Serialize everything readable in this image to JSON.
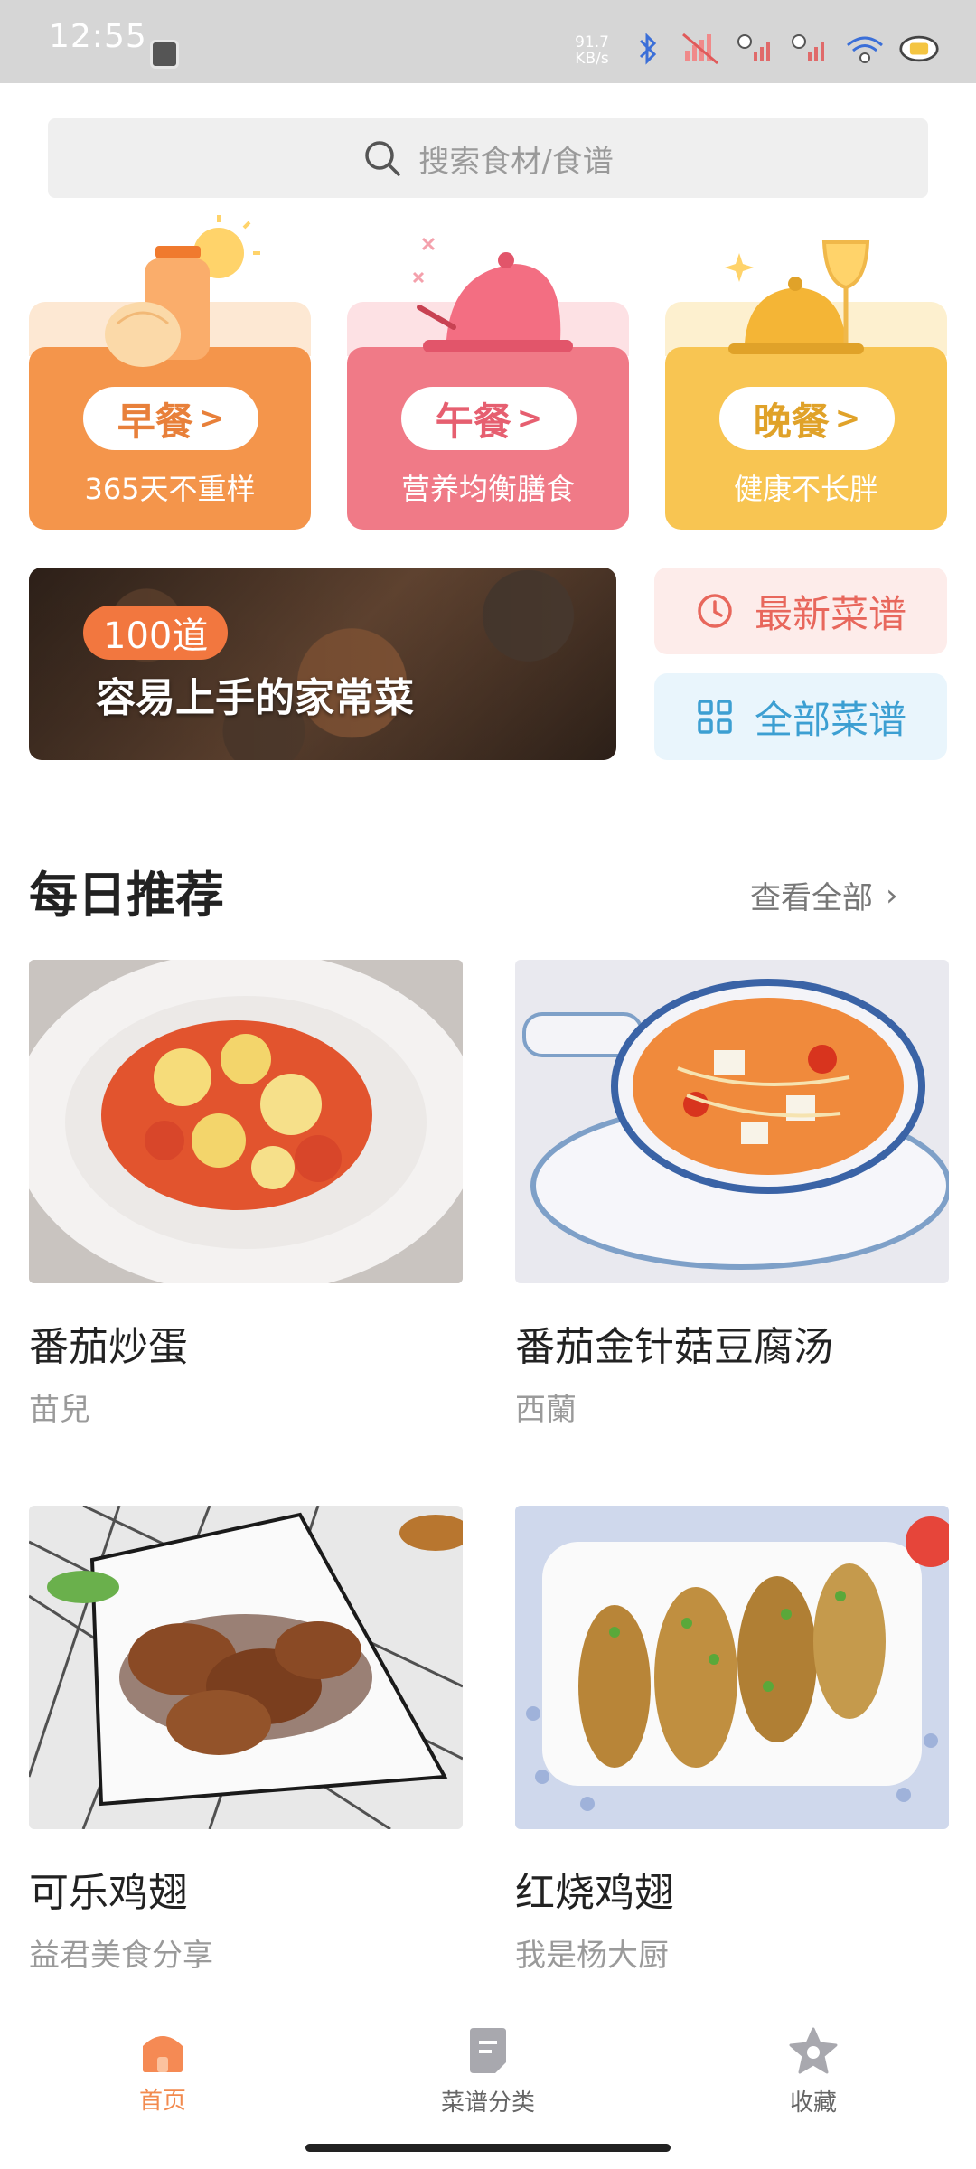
{
  "status_bar": {
    "time": "12:55",
    "net_speed_value": "91.7",
    "net_speed_unit": "KB/s"
  },
  "search": {
    "placeholder": "搜索食材/食谱"
  },
  "meal_cards": [
    {
      "label": "早餐",
      "subtitle": "365天不重样",
      "color": "#f4954b",
      "top_color": "#fde8d3",
      "text_color": "#e8803a"
    },
    {
      "label": "午餐",
      "subtitle": "营养均衡膳食",
      "color": "#f07a87",
      "top_color": "#fde1e4",
      "text_color": "#e65f70"
    },
    {
      "label": "晚餐",
      "subtitle": "健康不长胖",
      "color": "#f8c552",
      "top_color": "#fdf0cf",
      "text_color": "#e0a229"
    }
  ],
  "banner": {
    "badge": "100道",
    "title": "容易上手的家常菜"
  },
  "quick_links": {
    "latest": {
      "label": "最新菜谱",
      "color": "#e8675c",
      "bg": "#fdecea"
    },
    "all": {
      "label": "全部菜谱",
      "color": "#3c9fd2",
      "bg": "#e9f5fc"
    }
  },
  "daily": {
    "title": "每日推荐",
    "view_all": "查看全部"
  },
  "recipes": [
    {
      "name": "番茄炒蛋",
      "author": "苗兒"
    },
    {
      "name": "番茄金针菇豆腐汤",
      "author": "西蘭"
    },
    {
      "name": "可乐鸡翅",
      "author": "益君美食分享"
    },
    {
      "name": "红烧鸡翅",
      "author": "我是杨大厨"
    }
  ],
  "bottom_nav": {
    "home": "首页",
    "categories": "菜谱分类",
    "favorites": "收藏",
    "active_color": "#f28a4e",
    "inactive_color": "#666666"
  }
}
